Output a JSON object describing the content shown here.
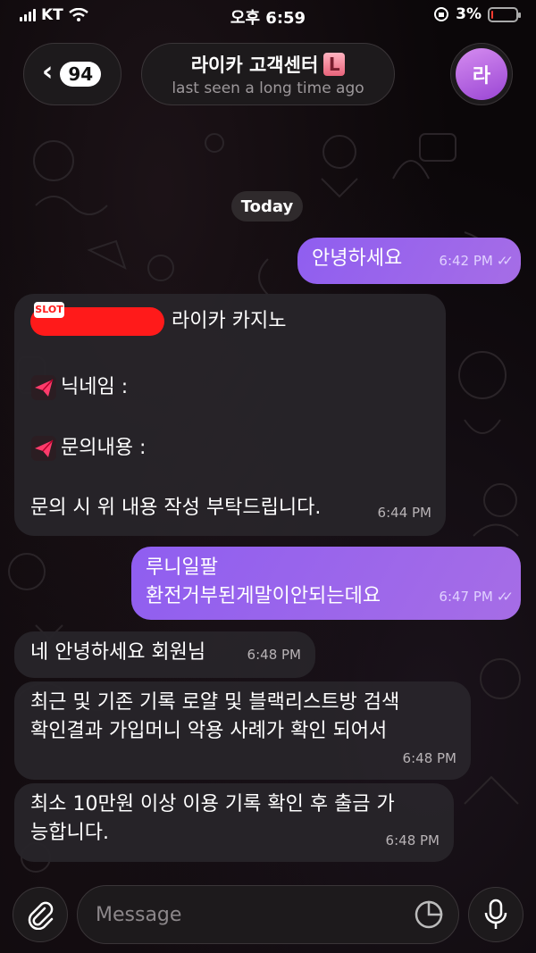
{
  "status_bar": {
    "carrier": "KT",
    "time": "오후 6:59",
    "battery_percent": "3%",
    "battery_level": 0.03
  },
  "header": {
    "back_badge": "94",
    "title": "라이카 고객센터",
    "title_emoji": "L",
    "subtitle": "last seen a long time ago",
    "avatar_letter": "라"
  },
  "date_label": "Today",
  "messages": [
    {
      "direction": "out",
      "lines": [
        "안녕하세요"
      ],
      "time": "6:42 PM",
      "read": true
    },
    {
      "direction": "in",
      "brand_badge": "SLOT",
      "header_text": "라이카 카지노",
      "field1": "닉네임 :",
      "field2": "문의내용 :",
      "footer": "문의 시 위 내용 작성 부탁드립니다.",
      "time": "6:44 PM"
    },
    {
      "direction": "out",
      "lines": [
        "루니일팔",
        "환전거부된게말이안되는데요"
      ],
      "time": "6:47 PM",
      "read": true
    },
    {
      "direction": "in",
      "lines": [
        "네 안녕하세요 회원님"
      ],
      "time": "6:48 PM"
    },
    {
      "direction": "in",
      "lines": [
        "최근 및 기존 기록 로얄 및 블랙리스트방 검색",
        "확인결과 가입머니 악용 사례가 확인 되어서"
      ],
      "time": "6:48 PM"
    },
    {
      "direction": "in",
      "lines": [
        "최소 10만원 이상 이용 기록 확인 후 출금 가",
        "능합니다."
      ],
      "time": "6:48 PM"
    }
  ],
  "input": {
    "placeholder": "Message"
  },
  "icons": {
    "back": "chevron-left-icon",
    "attach": "paperclip-icon",
    "sticker": "sticker-icon",
    "mic": "microphone-icon",
    "plane": "paper-plane-icon"
  },
  "colors": {
    "outgoing_bubble": "#9a66ec",
    "incoming_bubble": "#28242a",
    "avatar": "#b866e0",
    "brand_red": "#ff1a1a"
  }
}
